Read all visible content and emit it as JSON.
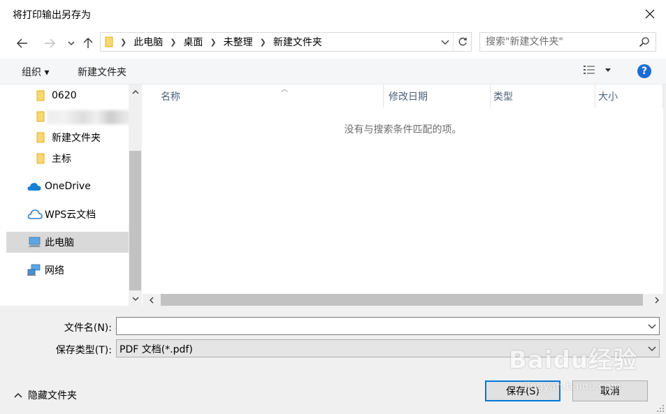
{
  "window": {
    "title": "将打印输出另存为"
  },
  "address_bar": {
    "crumbs": [
      "此电脑",
      "桌面",
      "未整理",
      "新建文件夹"
    ]
  },
  "search": {
    "placeholder": "搜索\"新建文件夹\""
  },
  "toolbar": {
    "organize_label": "组织 ▾",
    "new_folder_label": "新建文件夹"
  },
  "nav_pane": {
    "items": [
      {
        "label": "0620",
        "icon": "folder-icon"
      },
      {
        "label": "",
        "icon": "folder-icon"
      },
      {
        "label": "新建文件夹",
        "icon": "folder-icon"
      },
      {
        "label": "主标",
        "icon": "folder-icon"
      },
      {
        "label": "OneDrive",
        "icon": "onedrive-cloud-icon"
      },
      {
        "label": "WPS云文档",
        "icon": "wps-cloud-icon"
      },
      {
        "label": "此电脑",
        "icon": "computer-icon",
        "selected": true
      },
      {
        "label": "网络",
        "icon": "network-icon"
      }
    ]
  },
  "file_list": {
    "columns": [
      "名称",
      "修改日期",
      "类型",
      "大小"
    ],
    "empty_message": "没有与搜索条件匹配的项。"
  },
  "form": {
    "filename_label": "文件名(N):",
    "filename_value": "",
    "filetype_label": "保存类型(T):",
    "filetype_value": "PDF 文档(*.pdf)"
  },
  "footer": {
    "hide_folders_label": "隐藏文件夹",
    "save_label": "保存(S)",
    "cancel_label": "取消"
  },
  "watermark": {
    "logo_text": "Baidu经验",
    "url_text": "jingyan.baidu.com"
  },
  "colors": {
    "accent": "#0078d7",
    "selected_bg": "#d9d9d9",
    "folder": "#f8d775",
    "help": "#1a6dd5"
  }
}
